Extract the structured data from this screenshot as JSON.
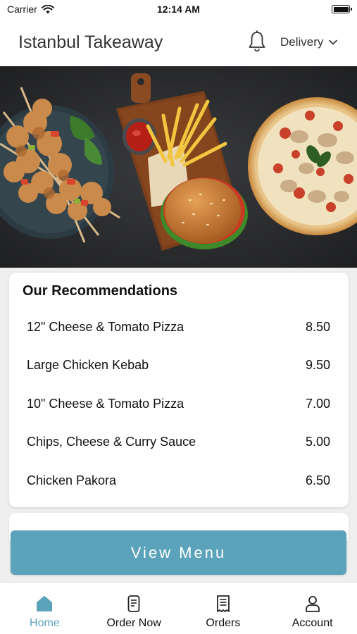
{
  "status_bar": {
    "carrier": "Carrier",
    "time": "12:14 AM"
  },
  "header": {
    "title": "Istanbul Takeaway",
    "notification_icon": "bell-icon",
    "order_type": "Delivery",
    "order_type_icon": "chevron-down-icon"
  },
  "hero": {
    "image": "food-banner: kebab skewers, chips with ketchup, burger, pizza"
  },
  "recommendations": {
    "title": "Our Recommendations",
    "items": [
      {
        "name": "12\" Cheese & Tomato Pizza",
        "price": "8.50"
      },
      {
        "name": "Large Chicken Kebab",
        "price": "9.50"
      },
      {
        "name": "10\" Cheese & Tomato Pizza",
        "price": "7.00"
      },
      {
        "name": "Chips, Cheese & Curry Sauce",
        "price": "5.00"
      },
      {
        "name": "Chicken Pakora",
        "price": "6.50"
      }
    ]
  },
  "view_menu_label": "View Menu",
  "tabs": [
    {
      "label": "Home",
      "icon": "home-icon",
      "active": true
    },
    {
      "label": "Order Now",
      "icon": "phone-icon",
      "active": false
    },
    {
      "label": "Orders",
      "icon": "receipt-icon",
      "active": false
    },
    {
      "label": "Account",
      "icon": "user-icon",
      "active": false
    }
  ],
  "colors": {
    "accent": "#5aa3bb",
    "text": "#111111",
    "background": "#efefef"
  }
}
